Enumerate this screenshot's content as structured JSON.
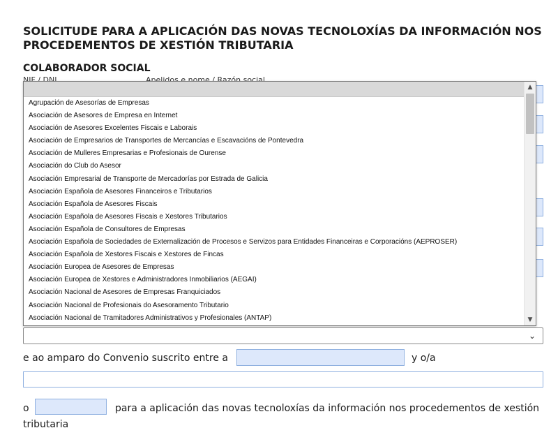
{
  "form": {
    "title": "SOLICITUDE PARA A APLICACIÓN DAS NOVAS TECNOLOXÍAS DA INFORMACIÓN NOS PROCEDEMENTOS DE XESTIÓN TRIBUTARIA",
    "section_title": "COLABORADOR SOCIAL",
    "label_nif": "NIF / DNI",
    "label_name": "Apelidos e nome / Razón social"
  },
  "dropdown": {
    "selected_value": "",
    "options": [
      "Agrupación de Asesorías de Empresas",
      "Asociación de Asesores de Empresa en Internet",
      "Asociación de Asesores Excelentes Fiscais e Laborais",
      "Asociación de Empresarios de Transportes de Mercancías e Escavacións de Pontevedra",
      "Asociación de Mulleres Empresarias e Profesionais de Ourense",
      "Asociación do Club do Asesor",
      "Asociación Empresarial de Transporte de Mercadorías por Estrada de Galicia",
      "Asociación Española de Asesores Financeiros e Tributarios",
      "Asociación Española de Asesores Fiscais",
      "Asociación Española de Asesores Fiscais e Xestores Tributarios",
      "Asociación Española de Consultores de Empresas",
      "Asociación Española de Sociedades de Externalización de Procesos e Servizos para Entidades Financeiras e Corporacións (AEPROSER)",
      "Asociación Española de Xestores Fiscais e Xestores de Fincas",
      "Asociación Europea de Asesores de Empresas",
      "Asociación Europea de Xestores e Administradores Inmobiliarios (AEGAI)",
      "Asociación Nacional de Asesores de Empresas Franquiciados",
      "Asociación Nacional de Profesionais do Asesoramento Tributario",
      "Asociación Nacional de Tramitadores Administrativos y Profesionales (ANTAP)"
    ]
  },
  "body_text": {
    "convenio_prefix": "e ao amparo do Convenio suscrito entre a",
    "convenio_suffix": "y o/a",
    "line3_prefix": "o",
    "line3_text": "para a aplicación das novas tecnoloxías da información nos procedementos de xestión",
    "line4_text": "tributaria"
  },
  "colors": {
    "input_fill": "#dde8fb",
    "input_border": "#8fb0e0"
  }
}
